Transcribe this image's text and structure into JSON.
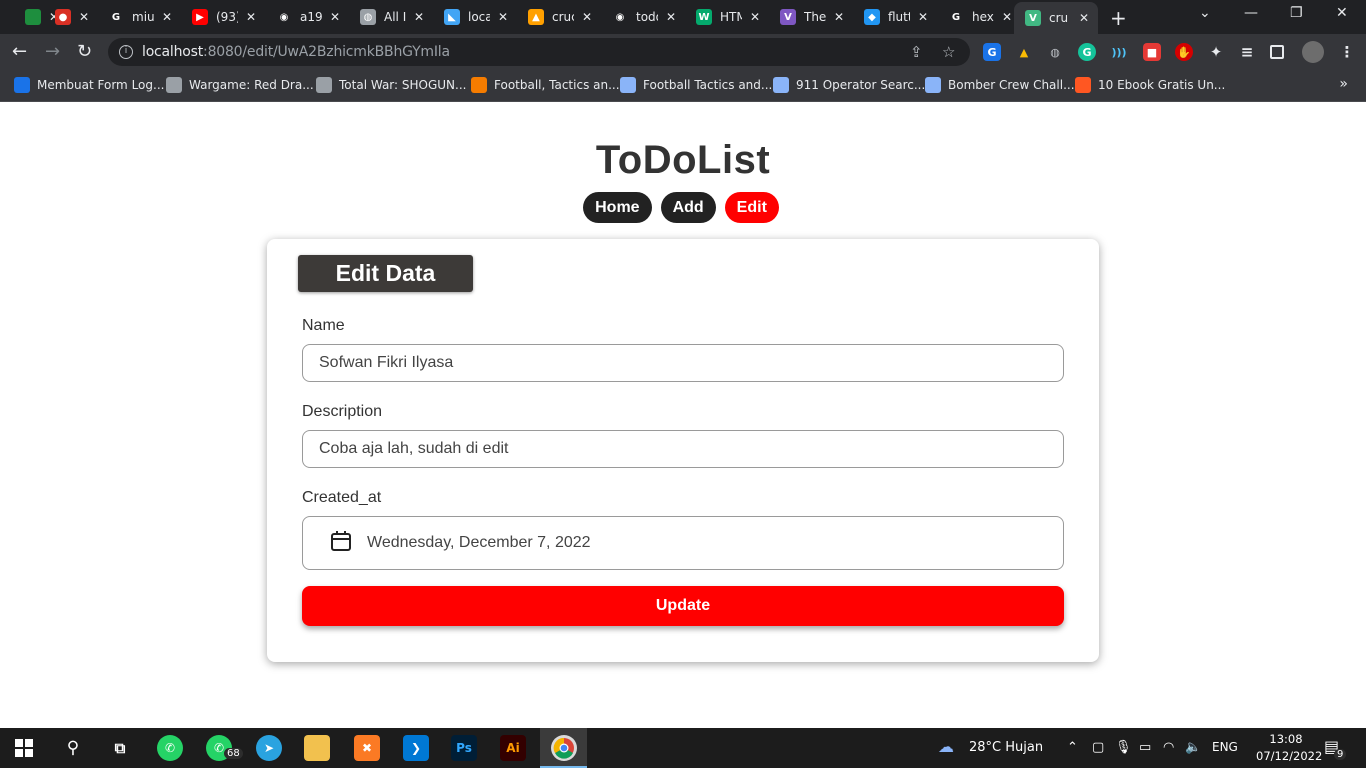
{
  "browser": {
    "tabs": [
      {
        "title": "",
        "fav_color": "#1e8e3e",
        "fav_glyph": "",
        "icon": "meet-icon"
      },
      {
        "title": "",
        "fav_color": "#d93025",
        "fav_glyph": "●",
        "icon": "record-icon"
      },
      {
        "title": "miu",
        "fav_color": "#ffffff",
        "fav_glyph": "G",
        "icon": "google-icon"
      },
      {
        "title": "(93)",
        "fav_color": "#ff0000",
        "fav_glyph": "▶",
        "icon": "youtube-icon"
      },
      {
        "title": "a19",
        "fav_color": "#ffffff",
        "fav_glyph": "◉",
        "icon": "github-icon"
      },
      {
        "title": "All I",
        "fav_color": "#9aa0a6",
        "fav_glyph": "◍",
        "icon": "web-icon"
      },
      {
        "title": "loca",
        "fav_color": "#42a5f5",
        "fav_glyph": "◣",
        "icon": "flutter-icon"
      },
      {
        "title": "cruc",
        "fav_color": "#ffa000",
        "fav_glyph": "▲",
        "icon": "firebase-icon"
      },
      {
        "title": "todo",
        "fav_color": "#ffffff",
        "fav_glyph": "◉",
        "icon": "github-icon"
      },
      {
        "title": "HTM",
        "fav_color": "#04aa6d",
        "fav_glyph": "W",
        "icon": "w3schools-icon"
      },
      {
        "title": "The",
        "fav_color": "#7e57c2",
        "fav_glyph": "V",
        "icon": "vuetify-icon"
      },
      {
        "title": "flutt",
        "fav_color": "#2196f3",
        "fav_glyph": "◆",
        "icon": "dart-icon"
      },
      {
        "title": "hex",
        "fav_color": "#ffffff",
        "fav_glyph": "G",
        "icon": "google-icon"
      },
      {
        "title": "cru",
        "fav_color": "#41b883",
        "fav_glyph": "V",
        "icon": "vue-icon"
      }
    ],
    "url_host": "localhost",
    "url_path": ":8080/edit/UwA2BzhicmkBBhGYmIla",
    "bookmarks": [
      {
        "label": "Membuat Form Log...",
        "color": "#1a73e8"
      },
      {
        "label": "Wargame: Red Dra...",
        "color": "#9aa0a6"
      },
      {
        "label": "Total War: SHOGUN...",
        "color": "#9aa0a6"
      },
      {
        "label": "Football, Tactics an...",
        "color": "#f57c00"
      },
      {
        "label": "Football Tactics and...",
        "color": "#8ab4f8"
      },
      {
        "label": "911 Operator Searc...",
        "color": "#8ab4f8"
      },
      {
        "label": "Bomber Crew Chall...",
        "color": "#8ab4f8"
      },
      {
        "label": "10 Ebook Gratis Un...",
        "color": "#ff5722"
      }
    ],
    "bookmarks_more": "»"
  },
  "app": {
    "title": "ToDoList",
    "nav": {
      "home": "Home",
      "add": "Add",
      "edit": "Edit"
    },
    "card_title": "Edit Data",
    "fields": {
      "name_label": "Name",
      "name_value": "Sofwan Fikri Ilyasa",
      "description_label": "Description",
      "description_value": "Coba aja lah, sudah di edit",
      "created_label": "Created_at",
      "created_value": "Wednesday, December 7, 2022"
    },
    "update_label": "Update",
    "colors": {
      "accent": "#ff0000",
      "dark_pill": "#222222",
      "header": "#3d3a38"
    }
  },
  "taskbar": {
    "whatsapp_badge": "68",
    "weather": "28°C  Hujan",
    "language": "ENG",
    "time": "13:08",
    "date": "07/12/2022",
    "notifications": "9"
  }
}
